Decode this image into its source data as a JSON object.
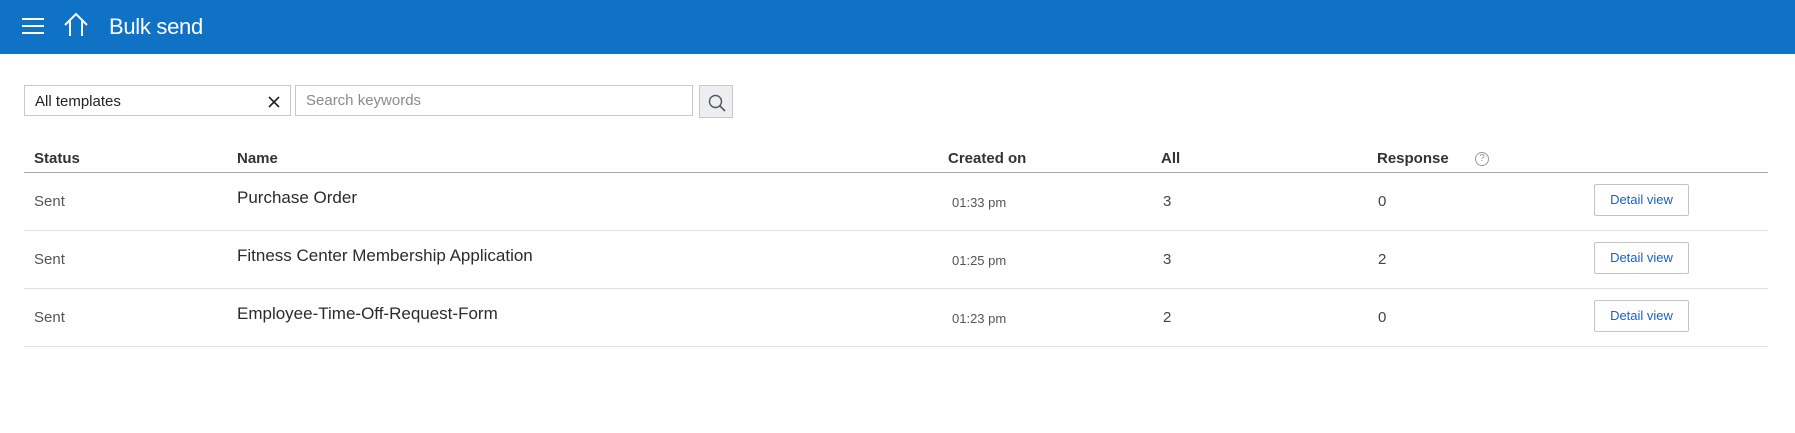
{
  "header": {
    "title": "Bulk send",
    "menu_icon": "hamburger-menu-icon",
    "home_icon": "home-icon",
    "background": "#1072c5"
  },
  "filters": {
    "template_value": "All templates",
    "clear_icon": "close-icon",
    "search_placeholder": "Search keywords",
    "search_value": "",
    "search_icon": "search-icon"
  },
  "table": {
    "columns": {
      "status": "Status",
      "name": "Name",
      "created_on": "Created on",
      "all": "All",
      "response": "Response",
      "response_help": "?"
    },
    "rows": [
      {
        "status": "Sent",
        "name": "Purchase Order",
        "created_on": "01:33 pm",
        "all": "3",
        "response": "0",
        "action": "Detail view"
      },
      {
        "status": "Sent",
        "name": "Fitness Center Membership Application",
        "created_on": "01:25 pm",
        "all": "3",
        "response": "2",
        "action": "Detail view"
      },
      {
        "status": "Sent",
        "name": "Employee-Time-Off-Request-Form",
        "created_on": "01:23 pm",
        "all": "2",
        "response": "0",
        "action": "Detail view"
      }
    ]
  },
  "colors": {
    "accent": "#1072c5",
    "link": "#1565c0"
  }
}
